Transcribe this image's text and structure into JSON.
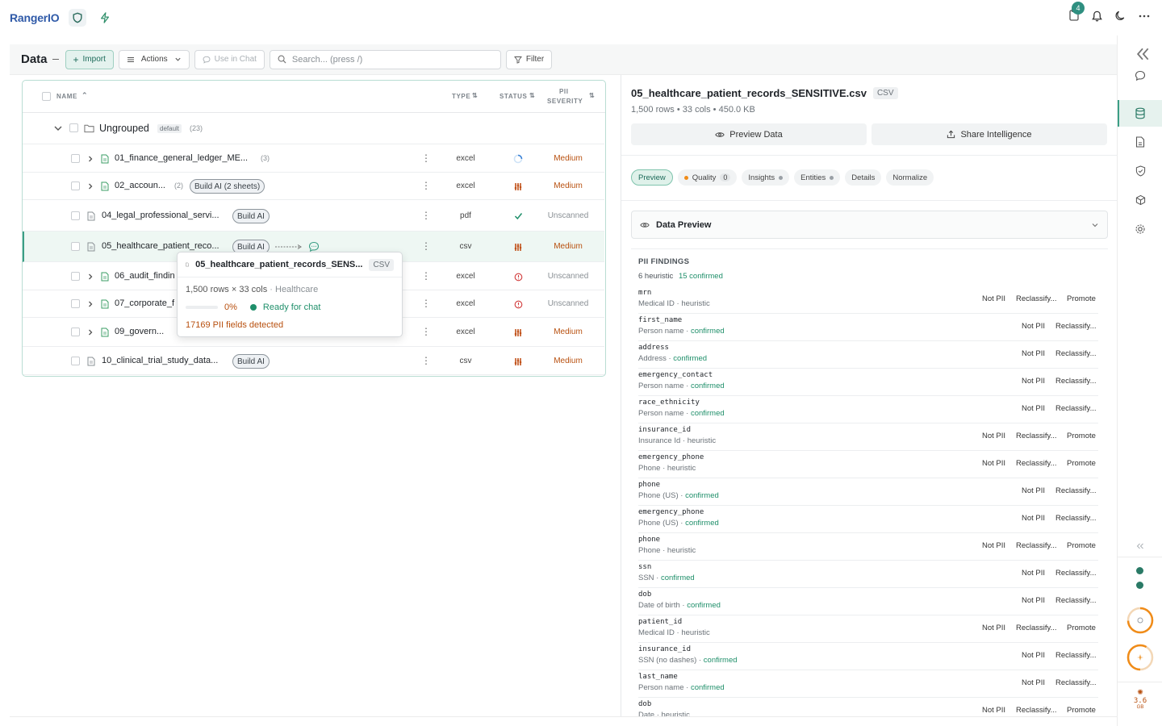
{
  "app": {
    "name": "RangerIO",
    "notification_count": "4"
  },
  "toolbar": {
    "title": "Data",
    "import_label": "Import",
    "actions_label": "Actions",
    "use_in_chat_label": "Use in Chat",
    "search_placeholder": "Search... (press /)",
    "filter_label": "Filter"
  },
  "table": {
    "headers": {
      "name": "NAME",
      "type": "TYPE",
      "status": "STATUS",
      "pii_severity_1": "PII",
      "pii_severity_2": "SEVERITY"
    },
    "group": {
      "name": "Ungrouped",
      "tag": "default",
      "count": "(23)"
    },
    "rows": [
      {
        "name": "01_finance_general_ledger_ME...",
        "count": "(3)",
        "build": "",
        "type": "excel",
        "status": "loading",
        "severity": "Medium"
      },
      {
        "name": "02_accoun...",
        "count": "(2)",
        "build": "Build AI (2 sheets)",
        "type": "excel",
        "status": "bars",
        "severity": "Medium"
      },
      {
        "name": "04_legal_professional_servi...",
        "count": "",
        "build": "Build AI",
        "type": "pdf",
        "status": "check",
        "severity": "Unscanned"
      },
      {
        "name": "05_healthcare_patient_reco...",
        "count": "",
        "build": "Build AI",
        "type": "csv",
        "status": "bars",
        "severity": "Medium"
      },
      {
        "name": "06_audit_findin",
        "count": "",
        "build": "",
        "type": "excel",
        "status": "error",
        "severity": "Unscanned"
      },
      {
        "name": "07_corporate_f",
        "count": "",
        "build": "",
        "type": "excel",
        "status": "error",
        "severity": "Unscanned"
      },
      {
        "name": "09_govern...",
        "count": "",
        "build": "",
        "type": "excel",
        "status": "bars",
        "severity": "Medium"
      },
      {
        "name": "10_clinical_trial_study_data...",
        "count": "",
        "build": "Build AI",
        "type": "csv",
        "status": "bars",
        "severity": "Medium"
      }
    ]
  },
  "popover": {
    "title": "05_healthcare_patient_records_SENS...",
    "chip": "CSV",
    "meta": "1,500 rows × 33 cols",
    "category": "Healthcare",
    "progress": "0%",
    "progress_fraction": 0,
    "ready": "Ready for chat",
    "pii": "17169 PII fields detected"
  },
  "detail": {
    "title": "05_healthcare_patient_records_SENSITIVE.csv",
    "chip": "CSV",
    "meta": "1,500 rows • 33 cols • 450.0 KB",
    "preview_btn": "Preview Data",
    "share_btn": "Share Intelligence",
    "tabs": [
      "Preview",
      "Quality",
      "Insights",
      "Entities",
      "Details",
      "Normalize"
    ],
    "quality_count": "0",
    "section": "Data Preview",
    "pii_heading": "PII FINDINGS",
    "pii_heuristic": "6 heuristic",
    "pii_confirmed": "15 confirmed",
    "findings": [
      {
        "field": "mrn",
        "type": "Medical ID",
        "method": "heuristic"
      },
      {
        "field": "first_name",
        "type": "Person name",
        "method": "confirmed"
      },
      {
        "field": "address",
        "type": "Address",
        "method": "confirmed"
      },
      {
        "field": "emergency_contact",
        "type": "Person name",
        "method": "confirmed"
      },
      {
        "field": "race_ethnicity",
        "type": "Person name",
        "method": "confirmed"
      },
      {
        "field": "insurance_id",
        "type": "Insurance Id",
        "method": "heuristic"
      },
      {
        "field": "emergency_phone",
        "type": "Phone",
        "method": "heuristic"
      },
      {
        "field": "phone",
        "type": "Phone (US)",
        "method": "confirmed"
      },
      {
        "field": "emergency_phone",
        "type": "Phone (US)",
        "method": "confirmed"
      },
      {
        "field": "phone",
        "type": "Phone",
        "method": "heuristic"
      },
      {
        "field": "ssn",
        "type": "SSN",
        "method": "confirmed"
      },
      {
        "field": "dob",
        "type": "Date of birth",
        "method": "confirmed"
      },
      {
        "field": "patient_id",
        "type": "Medical ID",
        "method": "heuristic"
      },
      {
        "field": "insurance_id",
        "type": "SSN (no dashes)",
        "method": "confirmed"
      },
      {
        "field": "last_name",
        "type": "Person name",
        "method": "confirmed"
      },
      {
        "field": "dob",
        "type": "Date",
        "method": "heuristic"
      }
    ],
    "action_not_pii": "Not PII",
    "action_reclassify": "Reclassify...",
    "action_promote": "Promote"
  },
  "rail": {
    "memory_value": "3.6",
    "memory_unit": "GB"
  },
  "colors": {
    "accent": "#3b9e85",
    "medium": "#b8500f",
    "confirmed": "#1f8f6a",
    "brand": "#2f5aa8",
    "warning_ring": "#f08c19"
  }
}
